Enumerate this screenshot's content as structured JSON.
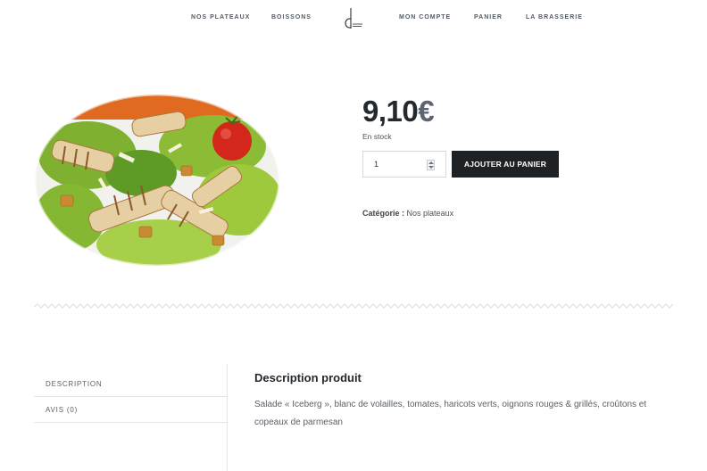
{
  "nav": {
    "items": [
      {
        "label": "NOS PLATEAUX"
      },
      {
        "label": "BOISSONS"
      },
      {
        "label": "MON COMPTE"
      },
      {
        "label": "PANIER"
      },
      {
        "label": "LA BRASSERIE"
      }
    ],
    "logo_icon": "brasserie-logo-icon"
  },
  "product": {
    "image_icon": "caesar-salad-image",
    "price_amount": "9,10",
    "price_currency": "€",
    "stock": "En stock",
    "quantity": "1",
    "add_to_cart_label": "AJOUTER AU PANIER",
    "category_label": "Catégorie :",
    "category_value": "Nos plateaux"
  },
  "tabs": [
    {
      "label": "DESCRIPTION"
    },
    {
      "label": "AVIS (0)"
    }
  ],
  "description": {
    "title": "Description produit",
    "text": "Salade « Iceberg », blanc de volailles, tomates, haricots verts, oignons rouges & grillés, croûtons et copeaux de parmesan"
  },
  "colors": {
    "button_bg": "#1f2225",
    "price": "#24292e",
    "currency": "#5b6470",
    "nav_text": "#545b63",
    "divider": "#e2e4e6"
  }
}
